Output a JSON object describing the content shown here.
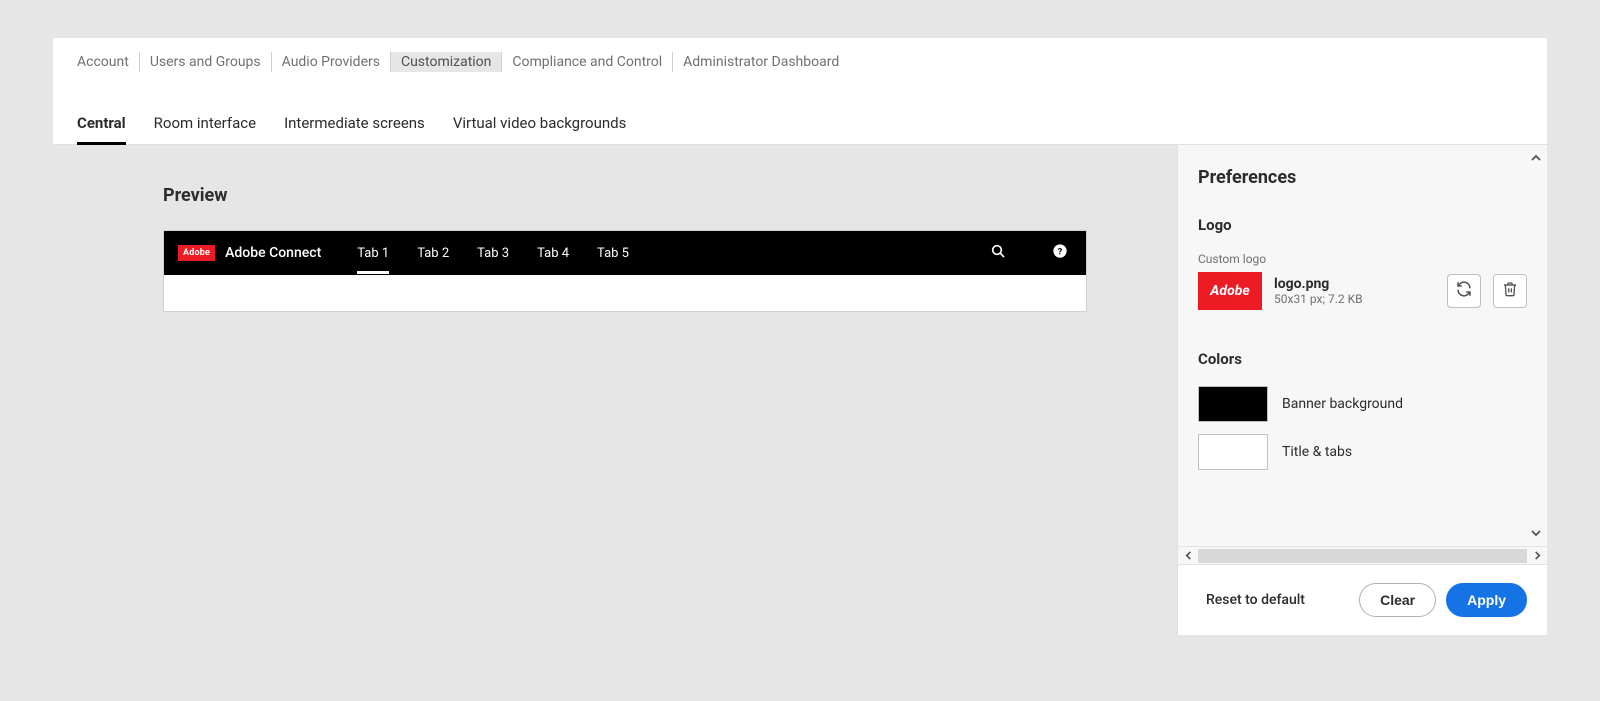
{
  "topnav": {
    "items": [
      {
        "label": "Account"
      },
      {
        "label": "Users and Groups"
      },
      {
        "label": "Audio Providers"
      },
      {
        "label": "Customization"
      },
      {
        "label": "Compliance and Control"
      },
      {
        "label": "Administrator Dashboard"
      }
    ]
  },
  "subtabs": {
    "items": [
      {
        "label": "Central"
      },
      {
        "label": "Room interface"
      },
      {
        "label": "Intermediate screens"
      },
      {
        "label": "Virtual video backgrounds"
      }
    ]
  },
  "preview": {
    "title": "Preview",
    "badge": "Adobe",
    "brand": "Adobe Connect",
    "tabs": [
      {
        "label": "Tab 1"
      },
      {
        "label": "Tab 2"
      },
      {
        "label": "Tab 3"
      },
      {
        "label": "Tab 4"
      },
      {
        "label": "Tab 5"
      }
    ]
  },
  "prefs": {
    "title": "Preferences",
    "logo_section": "Logo",
    "custom_logo_label": "Custom logo",
    "logo_thumb_text": "Adobe",
    "logo_name": "logo.png",
    "logo_details": "50x31 px; 7.2 KB",
    "colors_section": "Colors",
    "colors": {
      "banner_bg": {
        "label": "Banner background",
        "value": "#000000"
      },
      "title_tabs": {
        "label": "Title & tabs",
        "value": "#ffffff"
      }
    },
    "footer": {
      "reset": "Reset to default",
      "clear": "Clear",
      "apply": "Apply"
    }
  }
}
